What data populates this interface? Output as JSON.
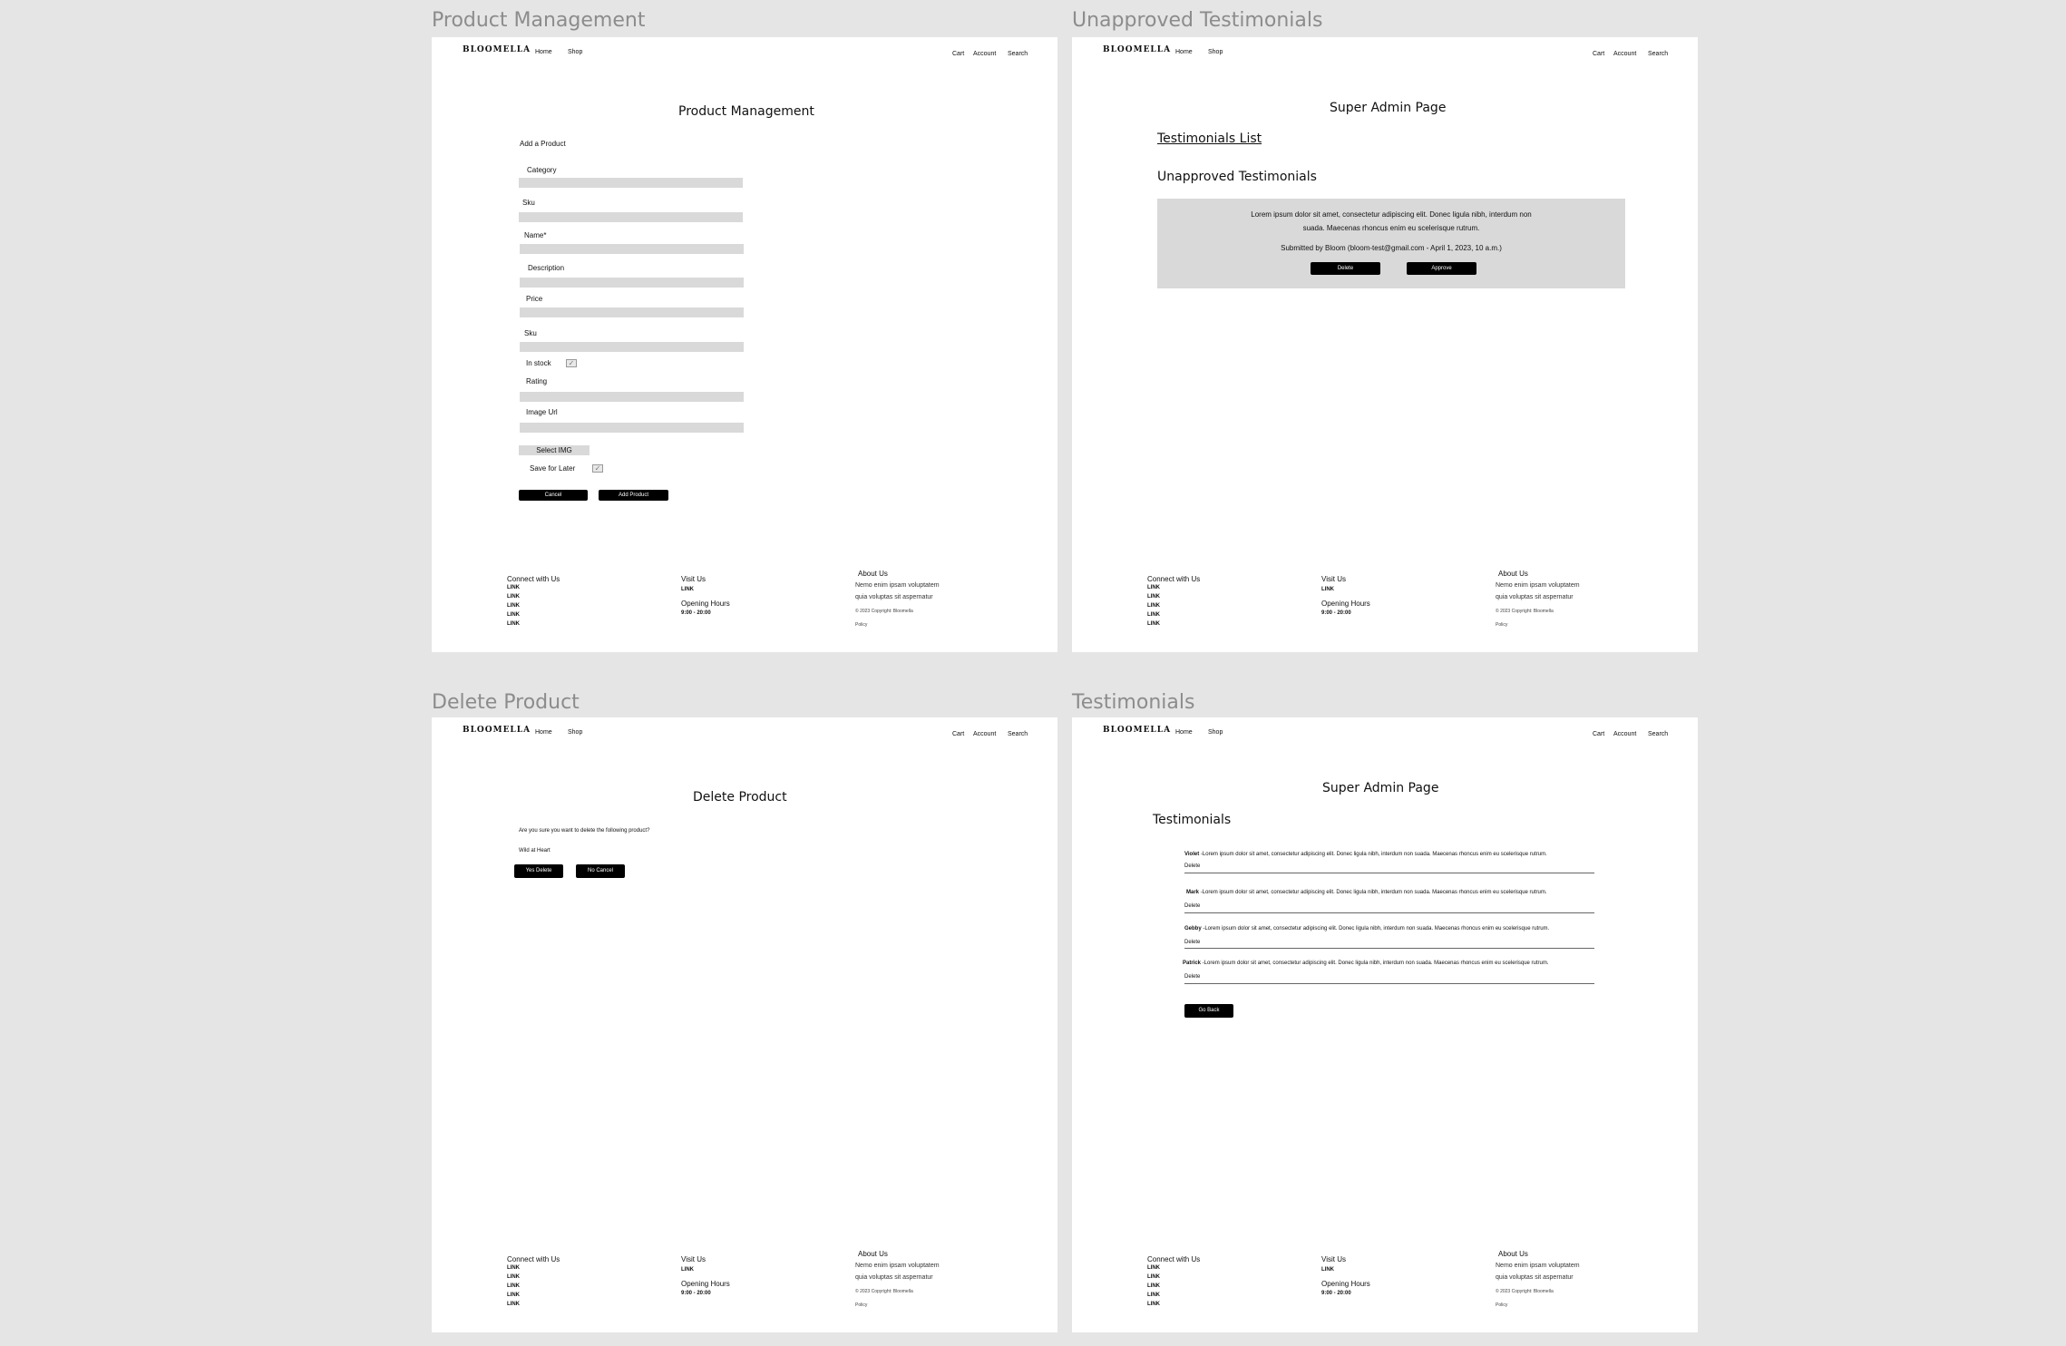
{
  "frames": {
    "product_management": {
      "frame_title": "Product Management",
      "heading": "Product Management",
      "add_label": "Add a Product",
      "fields": [
        "Category",
        "Sku",
        "Name*",
        "Description",
        "Price",
        "Sku"
      ],
      "in_stock_label": "In stock",
      "rating_label": "Rating",
      "image_url_label": "Image Url",
      "select_img_label": "Select IMG",
      "save_for_later_label": "Save for Later",
      "cancel_label": "Cancel",
      "add_product_label": "Add Product"
    },
    "unapproved_testimonials": {
      "frame_title": "Unapproved Testimonials",
      "heading": "Super Admin Page",
      "list_link": "Testimonials List",
      "subheading": "Unapproved Testimonials",
      "text_line1": "Lorem ipsum dolor sit amet, consectetur adipiscing elit. Donec ligula nibh, interdum non",
      "text_line2": "suada. Maecenas rhoncus enim eu scelerisque rutrum.",
      "submitted": "Submitted by Bloom (bloom-test@gmail.com - April 1, 2023, 10 a.m.)",
      "delete_label": "Delete",
      "approve_label": "Approve"
    },
    "delete_product": {
      "frame_title": "Delete Product",
      "heading": "Delete Product",
      "question": "Are you sure you want to delete the following product?",
      "product_name": "Wild at Heart",
      "yes_label": "Yes Delete",
      "no_label": "No Cancel"
    },
    "testimonials": {
      "frame_title": "Testimonials",
      "heading": "Super Admin Page",
      "subheading": "Testimonials",
      "items": [
        {
          "author": "Violet",
          "text": " -Lorem ipsum dolor sit amet, consectetur adipiscing elit. Donec ligula nibh, interdum non suada. Maecenas rhoncus enim eu scelerisque rutrum.",
          "delete": "Delete"
        },
        {
          "author": "Mark",
          "text": " -Lorem ipsum dolor sit amet, consectetur adipiscing elit. Donec ligula nibh, interdum non suada. Maecenas rhoncus enim eu scelerisque rutrum.",
          "delete": "Delete"
        },
        {
          "author": "Gebby",
          "text": " -Lorem ipsum dolor sit amet, consectetur adipiscing elit. Donec ligula nibh, interdum non suada. Maecenas rhoncus enim eu scelerisque rutrum.",
          "delete": "Delete"
        },
        {
          "author": "Patrick",
          "text": " -Lorem ipsum dolor sit amet, consectetur adipiscing elit. Donec ligula nibh, interdum non suada. Maecenas rhoncus enim eu scelerisque rutrum.",
          "delete": "Delete"
        }
      ],
      "go_back_label": "Go Back"
    }
  },
  "nav": {
    "logo": "BLOOMELLA",
    "home": "Home",
    "shop": "Shop",
    "cart": "Cart",
    "account": "Account",
    "search": "Search"
  },
  "footer": {
    "connect": "Connect with Us",
    "link": "LINK",
    "visit": "Visit Us",
    "hours_label": "Opening Hours",
    "hours": "9:00 - 20:00",
    "about": "About Us",
    "about_line1": "Nemo enim ipsam voluptatem",
    "about_line2": "quia voluptas sit aspernatur",
    "copyright": "© 2023 Copyright: Bloomella",
    "policy": "Policy"
  },
  "colors": {
    "background": "#e5e5e5",
    "frame": "#ffffff",
    "field": "#d9d9d9",
    "button": "#000000"
  }
}
